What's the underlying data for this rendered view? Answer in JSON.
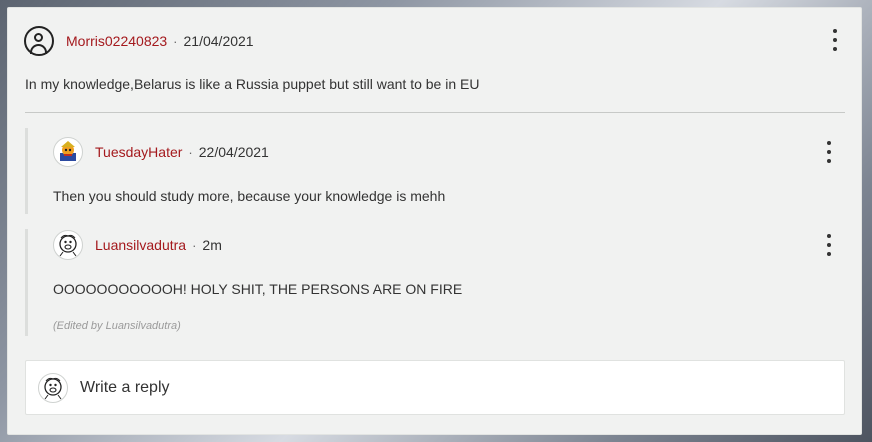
{
  "comment": {
    "username": "Morris02240823",
    "separator": "·",
    "date": "21/04/2021",
    "text": "In my knowledge,Belarus is like a Russia puppet but still want to be in EU",
    "avatar_icon": "user-circle-icon"
  },
  "replies": [
    {
      "username": "TuesdayHater",
      "separator": "·",
      "date": "22/04/2021",
      "text": "Then you should study more, because your knowledge is mehh",
      "avatar_icon": "cartoon-avatar-icon"
    },
    {
      "username": "Luansilvadutra",
      "separator": "·",
      "date": "2m",
      "text": "OOOOOOOOOOOH! HOLY SHIT, THE PERSONS ARE ON FIRE",
      "edited": "(Edited by Luansilvadutra)",
      "avatar_icon": "sketch-avatar-icon"
    }
  ],
  "reply_box": {
    "placeholder": "Write a reply",
    "avatar_icon": "sketch-avatar-icon"
  },
  "colors": {
    "username": "#a4191d",
    "card_bg": "#f1f2f1"
  }
}
